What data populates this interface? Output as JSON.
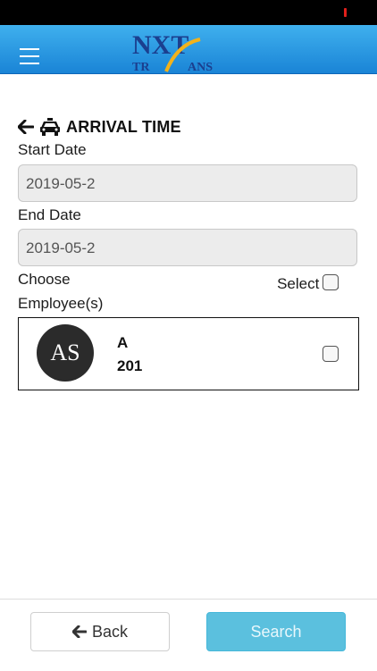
{
  "header": {
    "menu_icon": "hamburger-menu-icon",
    "logo_top": "NXT",
    "logo_bottom_left": "TR",
    "logo_bottom_right": "ANS",
    "colors": {
      "header_top": "#3fb0ee",
      "header_bottom": "#1a84d6",
      "logo_text": "#1b3f8f",
      "logo_swoosh": "#f2b21b"
    }
  },
  "page": {
    "back_icon": "arrow-left-icon",
    "taxi_icon": "taxi-icon",
    "title": "ARRIVAL TIME"
  },
  "form": {
    "start_date_label": "Start Date",
    "start_date_value": "2019-05-2",
    "end_date_label": "End Date",
    "end_date_value": "2019-05-2",
    "choose_line1": "Choose",
    "choose_line2": "Employee(s)",
    "select_all_label": "Select All"
  },
  "employees": [
    {
      "initials": "AS",
      "name": "A",
      "id": "201",
      "checked": false
    }
  ],
  "footer": {
    "back_label": "Back",
    "search_label": "Search",
    "colors": {
      "search_bg": "#5bc0de"
    }
  }
}
